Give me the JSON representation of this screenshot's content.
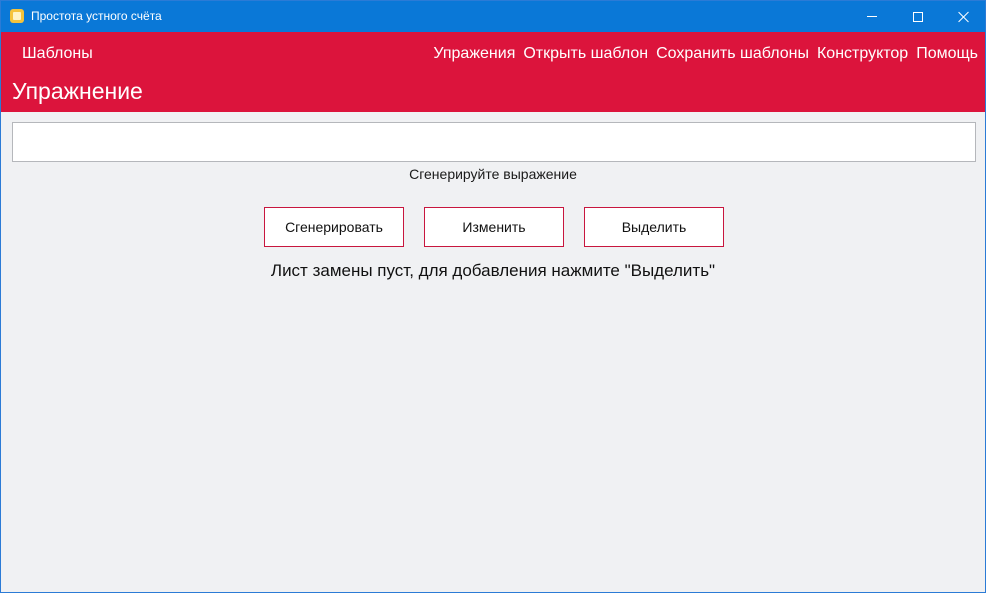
{
  "window": {
    "title": "Простота устного счёта",
    "icon": "app-icon",
    "controls": {
      "minimize": "minimize-icon",
      "maximize": "maximize-icon",
      "close": "close-icon"
    }
  },
  "header": {
    "left_link": "Шаблоны",
    "nav": [
      {
        "label": "Упражения"
      },
      {
        "label": "Открыть шаблон"
      },
      {
        "label": "Сохранить шаблоны"
      },
      {
        "label": "Конструктор"
      },
      {
        "label": "Помощь"
      }
    ],
    "title": "Упражнение",
    "background": "#dc143c"
  },
  "main": {
    "expression_value": "",
    "hint": "Сгенерируйте выражение",
    "buttons": {
      "generate": "Сгенерировать",
      "change": "Изменить",
      "select": "Выделить"
    },
    "status": "Лист замены пуст, для добавления нажмите \"Выделить\""
  },
  "colors": {
    "titlebar": "#0a78d7",
    "accent": "#dc143c",
    "background": "#f0f1f3"
  }
}
